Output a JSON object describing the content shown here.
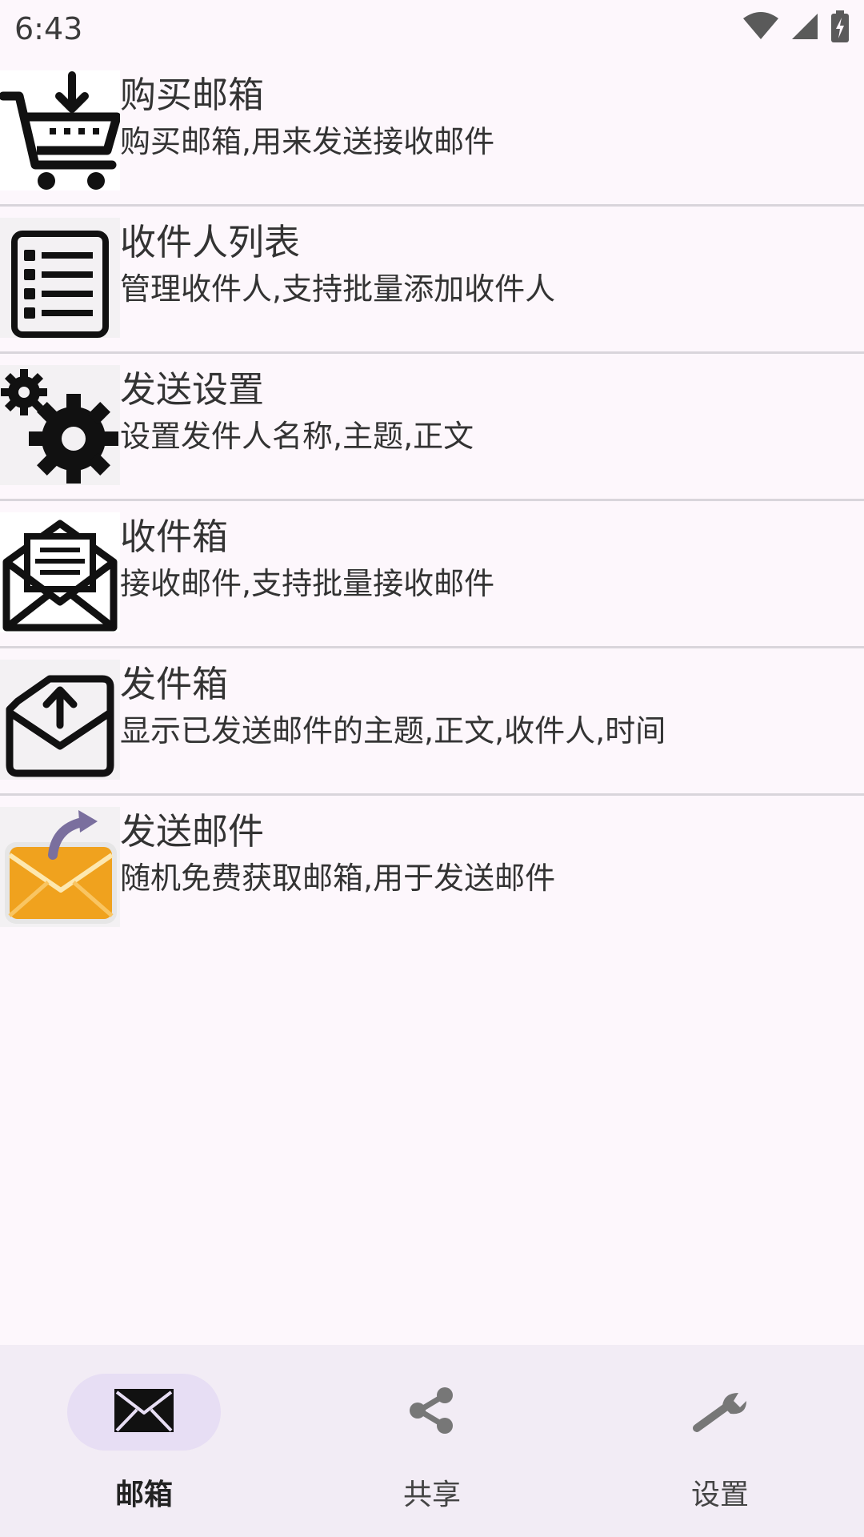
{
  "status_bar": {
    "time": "6:43",
    "icons": [
      "wifi-icon",
      "cell-signal-icon",
      "battery-charging-icon"
    ]
  },
  "list": {
    "items": [
      {
        "title": "购买邮箱",
        "desc": "购买邮箱,用来发送接收邮件",
        "icon": "cart-download-icon"
      },
      {
        "title": "收件人列表",
        "desc": "管理收件人,支持批量添加收件人",
        "icon": "list-icon"
      },
      {
        "title": "发送设置",
        "desc": "设置发件人名称,主题,正文",
        "icon": "gears-icon"
      },
      {
        "title": "收件箱",
        "desc": "接收邮件,支持批量接收邮件",
        "icon": "open-mail-icon"
      },
      {
        "title": "发件箱",
        "desc": "显示已发送邮件的主题,正文,收件人,时间",
        "icon": "mail-upload-icon"
      },
      {
        "title": "发送邮件",
        "desc": "随机免费获取邮箱,用于发送邮件",
        "icon": "send-mail-orange-icon"
      }
    ]
  },
  "bottom_nav": {
    "items": [
      {
        "label": "邮箱",
        "icon": "envelope-icon",
        "active": true
      },
      {
        "label": "共享",
        "icon": "share-icon",
        "active": false
      },
      {
        "label": "设置",
        "icon": "wrench-icon",
        "active": false
      }
    ]
  },
  "colors": {
    "background": "#fdf7fc",
    "nav_background": "#f2ecf5",
    "active_pill": "#e7def4",
    "divider": "#d9d5db",
    "mail_orange": "#f0a21e"
  }
}
